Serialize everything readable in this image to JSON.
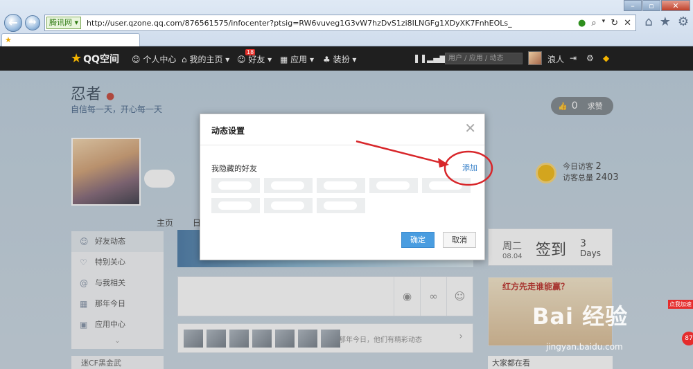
{
  "browser": {
    "site_badge": "腾讯网",
    "address": "http://user.qzone.qq.com/876561575/infocenter?ptsig=RW6vuveg1G3vW7hzDvS1zi8ILNGFg1XDyXK7FnhEOLs_"
  },
  "qnav": {
    "logo": "QQ空间",
    "items": [
      "个人中心",
      "我的主页",
      "好友",
      "应用",
      "装扮"
    ],
    "friends_badge": "18",
    "search_placeholder": "用户 / 应用 / 动态",
    "username": "浪人"
  },
  "profile": {
    "name": "忍者",
    "motto": "自信每一天，开心每一天",
    "like_count": "0",
    "like_label": "求赞",
    "visits_today_label": "今日访客",
    "visits_today": "2",
    "visits_total_label": "访客总量",
    "visits_total": "2403"
  },
  "tabs": [
    "主页",
    "日志"
  ],
  "sidebar": {
    "items": [
      "好友动态",
      "特别关心",
      "与我相关",
      "那年今日",
      "应用中心"
    ],
    "bottom": "迷CF黑金武"
  },
  "feed": {
    "friends_note": "那年今日，他们有精彩动态"
  },
  "checkin": {
    "weekday": "周二",
    "date": "08.04",
    "label": "签到",
    "days_num": "3",
    "days_label": "Days"
  },
  "poster": {
    "title": "红方先走谁能赢？"
  },
  "news": {
    "title": "大家都在看"
  },
  "dialog": {
    "title": "动态设置",
    "hidden_friends_label": "我隐藏的好友",
    "add_link": "添加",
    "ok_button": "确定",
    "cancel_button": "取消"
  },
  "watermark": {
    "main": "Bai 经验",
    "sub": "jingyan.baidu.com"
  },
  "accel": {
    "label": "点我加速",
    "badge": "87"
  },
  "colors": {
    "accent_blue": "#4a9de0",
    "link_blue": "#2f7bc6",
    "annotation_red": "#d8262a",
    "nav_dark": "#1f1f1f"
  }
}
